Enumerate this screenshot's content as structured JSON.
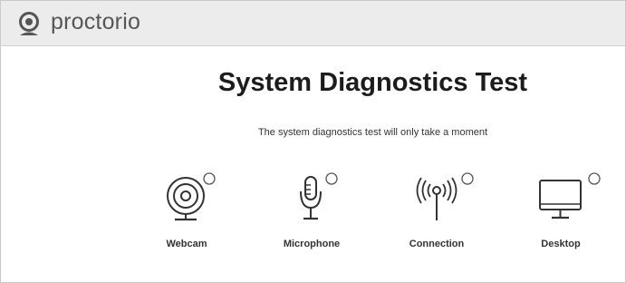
{
  "header": {
    "brand": "proctorio"
  },
  "main": {
    "title": "System Diagnostics Test",
    "subtitle": "The system diagnostics test will only take a moment"
  },
  "checks": [
    {
      "label": "Webcam",
      "icon": "webcam-icon",
      "status": "pending"
    },
    {
      "label": "Microphone",
      "icon": "microphone-icon",
      "status": "pending"
    },
    {
      "label": "Connection",
      "icon": "connection-icon",
      "status": "pending"
    },
    {
      "label": "Desktop",
      "icon": "desktop-icon",
      "status": "pending"
    }
  ],
  "colors": {
    "header_bg": "#ececec",
    "icon_stroke": "#333333",
    "title": "#1c1c1c"
  }
}
